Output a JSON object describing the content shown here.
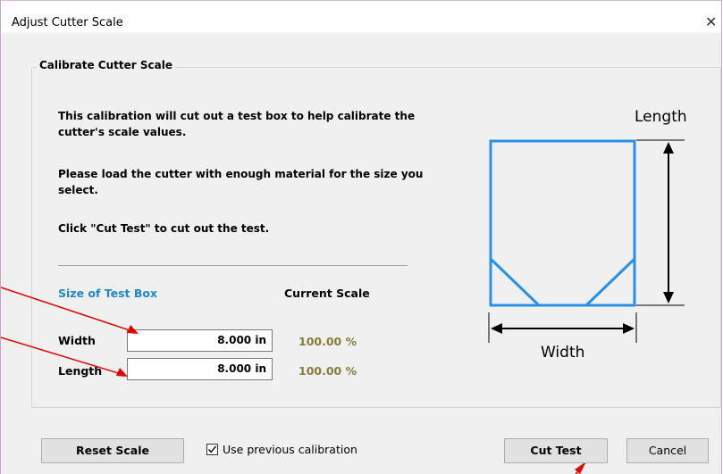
{
  "window": {
    "title": "Adjust Cutter Scale",
    "close_glyph": "✕"
  },
  "group": {
    "title": "Calibrate Cutter Scale"
  },
  "instructions": {
    "p1_line1": "This calibration will cut out a test box to help calibrate the",
    "p1_line2": "cutter's scale values.",
    "p2_line1": "Please load the cutter with enough material for the size you",
    "p2_line2": "select.",
    "p3": "Click \"Cut Test\" to cut out the test."
  },
  "table": {
    "size_header": "Size of Test Box",
    "scale_header": "Current Scale",
    "rows": [
      {
        "label": "Width",
        "value": "8.000 in",
        "scale": "100.00 %"
      },
      {
        "label": "Length",
        "value": "8.000 in",
        "scale": "100.00 %"
      }
    ]
  },
  "diagram": {
    "length_label": "Length",
    "width_label": "Width",
    "box_color": "#2a8fe6"
  },
  "footer": {
    "reset_label": "Reset Scale",
    "checkbox_label": "Use previous calibration",
    "checkbox_checked": true,
    "cut_test_label": "Cut Test",
    "cancel_label": "Cancel"
  },
  "annotation_color": "#e00000",
  "icons": [
    "close-icon",
    "checkmark-icon",
    "test-box-diagram-icon"
  ]
}
